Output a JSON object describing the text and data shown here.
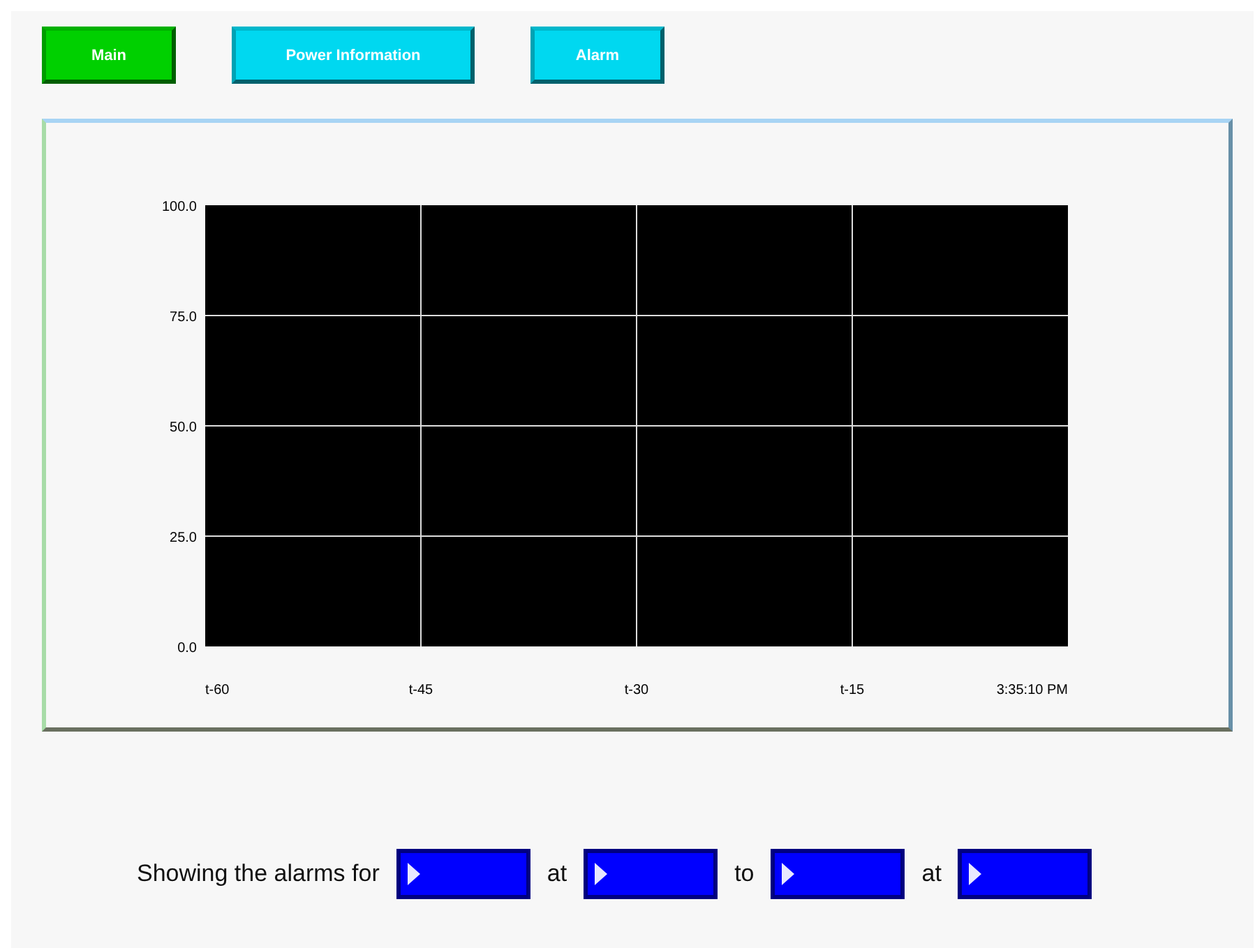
{
  "nav_buttons": [
    {
      "label": "Main",
      "color": "#00d000"
    },
    {
      "label": "Power Information",
      "color": "#00d8f0"
    },
    {
      "label": "Alarm",
      "color": "#00d8f0"
    }
  ],
  "trend_panel": {
    "chart_data": {
      "type": "line",
      "grid": true,
      "x": [
        "t-60",
        "t-45",
        "t-30",
        "t-15",
        "3:35:10 PM"
      ],
      "ylim": [
        0,
        100
      ],
      "yticks": [
        {
          "value": 0,
          "label": "0.0"
        },
        {
          "value": 25,
          "label": "25.0"
        },
        {
          "value": 50,
          "label": "50.0"
        },
        {
          "value": 75,
          "label": "75.0"
        },
        {
          "value": 100,
          "label": "100.0"
        }
      ]
    }
  },
  "alarm_filter": [
    {
      "kind": "text",
      "text": "Showing the alarms for"
    },
    {
      "kind": "field"
    },
    {
      "kind": "text",
      "text": "at"
    },
    {
      "kind": "field"
    },
    {
      "kind": "text",
      "text": "to"
    },
    {
      "kind": "field"
    },
    {
      "kind": "text",
      "text": "at"
    },
    {
      "kind": "field"
    }
  ]
}
